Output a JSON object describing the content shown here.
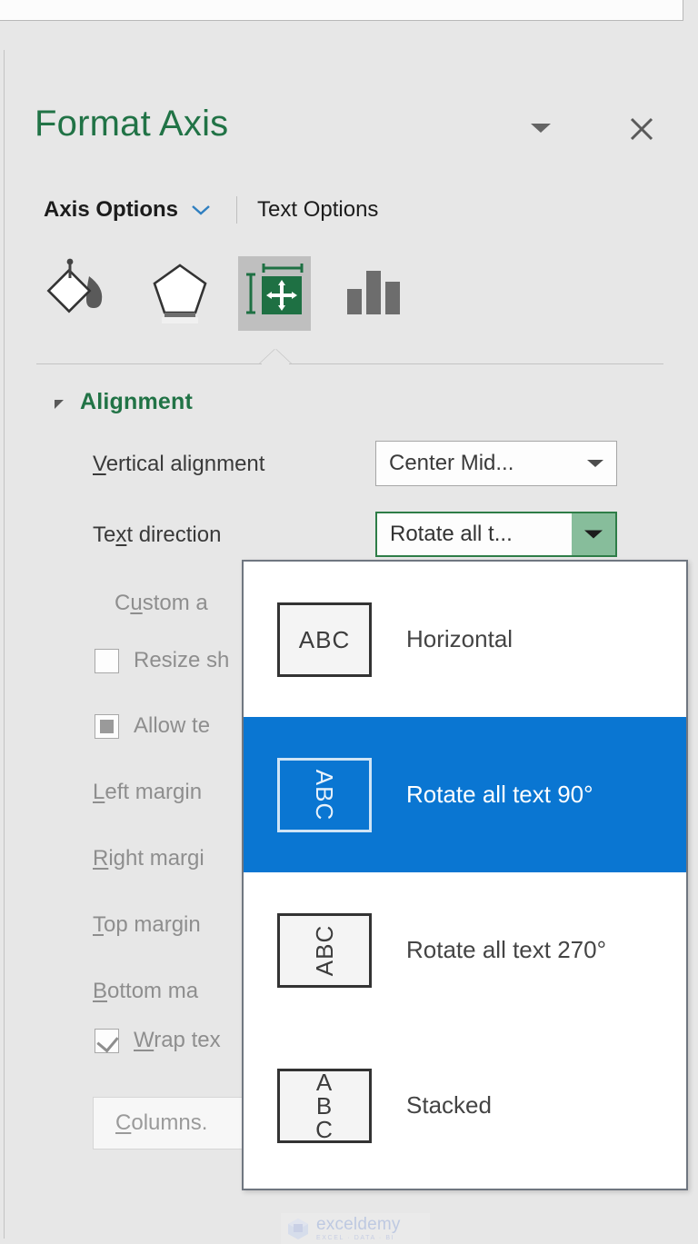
{
  "window": {
    "pane_title": "Format Axis",
    "collapse_icon": "chevron-down-icon",
    "close_icon": "close-icon"
  },
  "option_tabs": {
    "axis_options": "Axis Options",
    "axis_options_caret": "chevron-down-icon",
    "text_options": "Text Options"
  },
  "icon_tabs": [
    {
      "name": "fill-and-line-icon",
      "label": "Fill & Line",
      "active": false
    },
    {
      "name": "effects-icon",
      "label": "Effects",
      "active": false
    },
    {
      "name": "size-and-properties-icon",
      "label": "Size & Properties",
      "active": true
    },
    {
      "name": "axis-options-chart-icon",
      "label": "Axis Options",
      "active": false
    }
  ],
  "alignment": {
    "section_title": "Alignment",
    "collapse_arrow": "triangle-expanded-icon",
    "vertical_alignment": {
      "label": "Vertical alignment",
      "accelerator": "V",
      "value": "Center Mid..."
    },
    "text_direction": {
      "label": "Text direction",
      "accelerator": "x",
      "value": "Rotate all t..."
    },
    "custom_angle": {
      "label": "Custom a",
      "accelerator": "u"
    },
    "resize_shape": {
      "label": "Resize sh",
      "checked": false
    },
    "allow_text": {
      "label": "Allow te",
      "checked": true,
      "style": "filled-square"
    },
    "left_margin": {
      "label": "Left margin",
      "accelerator": "L"
    },
    "right_margin": {
      "label": "Right margi",
      "accelerator": "R"
    },
    "top_margin": {
      "label": "Top margin",
      "accelerator": "T"
    },
    "bottom_margin": {
      "label": "Bottom ma",
      "accelerator": "B"
    },
    "wrap_text": {
      "label": "Wrap tex",
      "accelerator": "W",
      "checked": true
    },
    "columns_button": {
      "label": "Columns.",
      "accelerator": "C"
    }
  },
  "dropdown": {
    "open": true,
    "items": [
      {
        "label": "Horizontal",
        "thumb_text": "ABC",
        "thumb_style": "horizontal",
        "selected": false
      },
      {
        "label": "Rotate all text 90°",
        "thumb_text": "ABC",
        "thumb_style": "rotate-90",
        "selected": true
      },
      {
        "label": "Rotate all text 270°",
        "thumb_text": "ABC",
        "thumb_style": "rotate-270",
        "selected": false
      },
      {
        "label": "Stacked",
        "thumb_text": "A\nB\nC",
        "thumb_style": "stacked",
        "selected": false
      }
    ]
  },
  "watermark": {
    "name": "exceldemy",
    "tagline": "EXCEL · DATA · BI"
  },
  "colors": {
    "pane_bg": "#e7e7e7",
    "title_green": "#217346",
    "section_green": "#217346",
    "combo_border_green": "#2e7d47",
    "combo_button_green": "#87bd9b",
    "selection_blue": "#0a76d2",
    "active_icon_bg": "#bfbfbf"
  }
}
